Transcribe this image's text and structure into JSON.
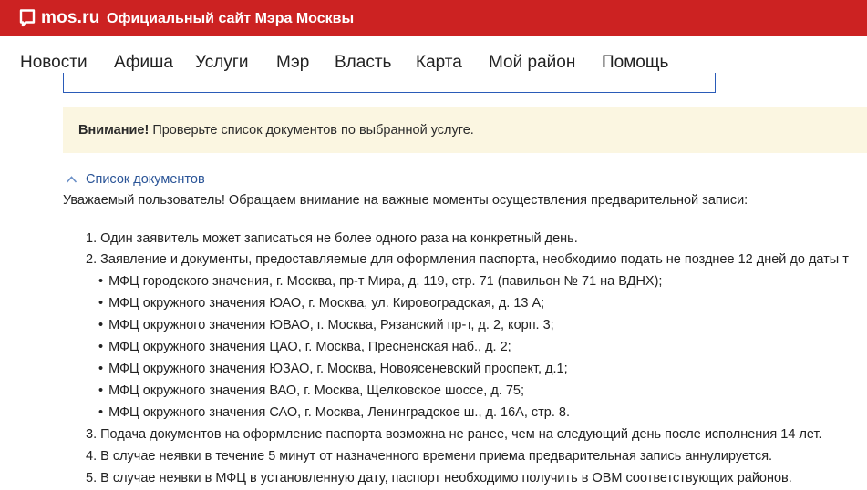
{
  "header": {
    "logo_text": "mos.ru",
    "site_title": "Официальный сайт Мэра Москвы"
  },
  "nav": {
    "items": [
      "Новости",
      "Афиша",
      "Услуги",
      "Мэр",
      "Власть",
      "Карта",
      "Мой район",
      "Помощь"
    ]
  },
  "alert": {
    "bold": "Внимание!",
    "text": "Проверьте список документов по выбранной услуге."
  },
  "documents": {
    "toggle_label": "Список документов",
    "intro": "Уважаемый пользователь! Обращаем внимание на важные моменты осуществления предварительной записи:",
    "items": [
      "1. Один заявитель может записаться не более одного раза на конкретный день.",
      "2. Заявление и документы, предоставляемые для оформления паспорта, необходимо подать не позднее 12 дней до даты т",
      "3. Подача документов на оформление паспорта возможна не ранее, чем на следующий день после исполнения 14 лет.",
      "4. В случае неявки в течение 5 минут от назначенного времени приема предварительная запись аннулируется.",
      "5. В случае неявки в МФЦ в установленную дату, паспорт необходимо получить в ОВМ соответствующих районов."
    ],
    "sub_items": [
      "МФЦ городского значения, г. Москва, пр-т Мира, д. 119, стр. 71 (павильон № 71 на ВДНХ);",
      "МФЦ окружного значения ЮАО, г. Москва, ул. Кировоградская, д. 13 А;",
      "МФЦ окружного значения ЮВАО, г. Москва, Рязанский пр-т, д. 2, корп. 3;",
      "МФЦ окружного значения ЦАО, г. Москва, Пресненская наб., д. 2;",
      "МФЦ окружного значения ЮЗАО, г. Москва, Новоясеневский проспект, д.1;",
      "МФЦ окружного значения ВАО, г. Москва, Щелковское шоссе, д. 75;",
      "МФЦ окружного значения САО, г. Москва, Ленинградское ш., д. 16А, стр. 8."
    ]
  },
  "colors": {
    "header_bg": "#cc2222",
    "alert_bg": "#fbf6e1",
    "link": "#2a5497"
  }
}
